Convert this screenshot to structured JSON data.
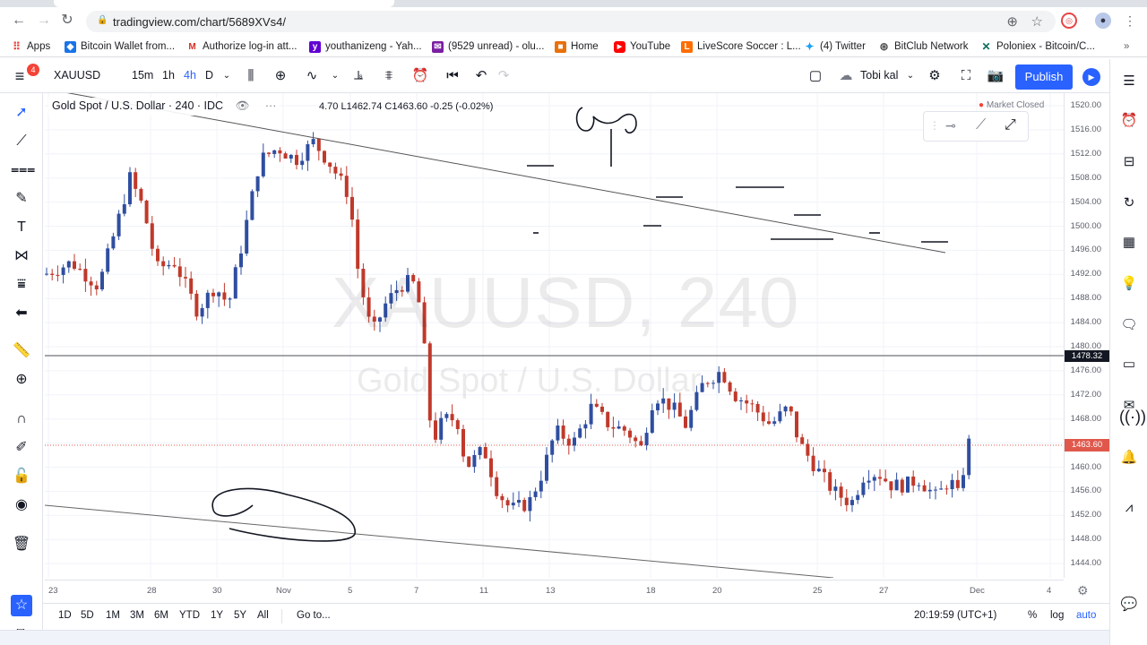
{
  "browser": {
    "url": "tradingview.com/chart/5689XVs4/",
    "bookmarks": [
      {
        "label": "Apps"
      },
      {
        "label": "Bitcoin Wallet from..."
      },
      {
        "label": "Authorize log-in att..."
      },
      {
        "label": "youthanizeng - Yah..."
      },
      {
        "label": "(9529 unread) - olu..."
      },
      {
        "label": "Home"
      },
      {
        "label": "YouTube"
      },
      {
        "label": "LiveScore Soccer : L..."
      },
      {
        "label": "(4) Twitter"
      },
      {
        "label": "BitClub Network"
      },
      {
        "label": "Poloniex - Bitcoin/C..."
      }
    ]
  },
  "toolbar": {
    "symbol": "XAUUSD",
    "intervals": [
      "15m",
      "1h",
      "4h",
      "D"
    ],
    "layout_name": "Tobi kal",
    "publish_label": "Publish",
    "notification_count": "4"
  },
  "legend": {
    "title": "Gold Spot / U.S. Dollar · 240 · IDC",
    "ohlc": "4.70  L1462.74  C1463.60  -0.25 (-0.02%)",
    "status": "Market Closed"
  },
  "watermark": {
    "line1": "XAUUSD, 240",
    "line2": "Gold Spot / U.S. Dollar"
  },
  "price_axis": {
    "labels": [
      "1520.00",
      "1516.00",
      "1512.00",
      "1508.00",
      "1504.00",
      "1500.00",
      "1496.00",
      "1492.00",
      "1488.00",
      "1484.00",
      "1480.00",
      "1476.00",
      "1472.00",
      "1468.00",
      "1464.00",
      "1460.00",
      "1456.00",
      "1452.00",
      "1448.00",
      "1444.00"
    ],
    "crosshair_price": "1478.32",
    "last_price": "1463.60"
  },
  "time_axis": {
    "labels": [
      "23",
      "28",
      "30",
      "Nov",
      "5",
      "7",
      "11",
      "13",
      "18",
      "20",
      "25",
      "27",
      "Dec",
      "4"
    ]
  },
  "bottom_bar": {
    "ranges": [
      "1D",
      "5D",
      "1M",
      "3M",
      "6M",
      "YTD",
      "1Y",
      "5Y",
      "All"
    ],
    "goto_label": "Go to...",
    "clock": "20:19:59 (UTC+1)",
    "percent_label": "%",
    "log_label": "log",
    "auto_label": "auto"
  },
  "colors": {
    "up": "#2f4ea0",
    "down": "#c0392b",
    "accent": "#2962ff",
    "last_price": "#e0584c"
  }
}
